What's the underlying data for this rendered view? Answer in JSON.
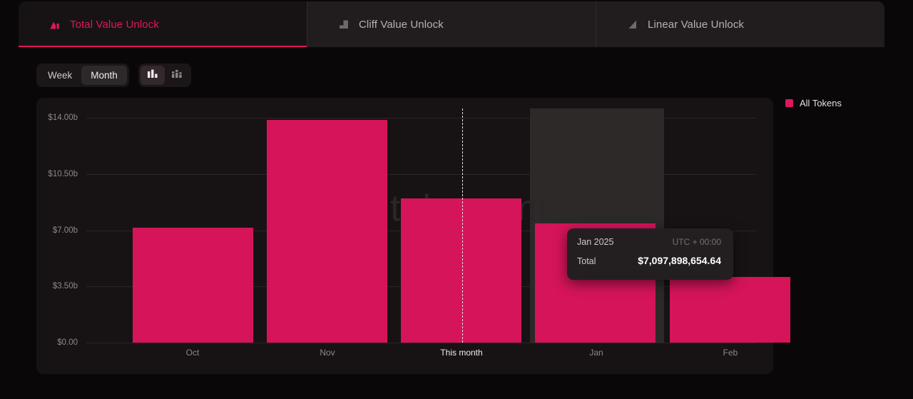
{
  "tabs": [
    {
      "label": "Total Value Unlock",
      "icon": "bars-ascending-icon",
      "active": true
    },
    {
      "label": "Cliff Value Unlock",
      "icon": "step-cliff-icon",
      "active": false
    },
    {
      "label": "Linear Value Unlock",
      "icon": "linear-ramp-icon",
      "active": false
    }
  ],
  "toolbar": {
    "week_label": "Week",
    "month_label": "Month",
    "selected_range": "Month",
    "chart_type_grouped_icon": "bar-chart-icon",
    "chart_type_stacked_icon": "stacked-bar-chart-icon",
    "selected_chart_type": "bar-chart-icon"
  },
  "legend": {
    "items": [
      {
        "label": "All Tokens",
        "color": "#e0165f"
      }
    ]
  },
  "tooltip": {
    "date": "Jan 2025",
    "timezone": "UTC + 00:00",
    "metric_label": "Total",
    "metric_value": "$7,097,898,654.64"
  },
  "watermark": "tokenomi",
  "colors": {
    "accent": "#e0165f",
    "bar": "#d5145a",
    "panel_bg": "#171314",
    "tabbar_bg": "#211d1e",
    "page_bg": "#0a0708",
    "highlight_col": "#2e2929"
  },
  "chart_data": {
    "type": "bar",
    "title": "",
    "xlabel": "",
    "ylabel": "",
    "categories": [
      "Oct",
      "Nov",
      "This month",
      "Jan",
      "Feb"
    ],
    "values": [
      6.84,
      13.56,
      8.98,
      7.42,
      4.09
    ],
    "value_labels": [
      "$6.84b",
      "$13.56b",
      "$8.98b",
      "$7.42b",
      "$4.09b"
    ],
    "series": [
      {
        "name": "All Tokens",
        "color": "#d5145a",
        "values": [
          6.84,
          13.56,
          8.98,
          7.42,
          4.09
        ]
      }
    ],
    "ylim": [
      0,
      14
    ],
    "yticks": [
      0,
      3.5,
      7.0,
      10.5,
      14.0
    ],
    "ytick_labels": [
      "$0.00",
      "$3.50b",
      "$7.00b",
      "$10.50b",
      "$14.00b"
    ],
    "grid": true,
    "legend_position": "right",
    "highlighted_category": "Jan",
    "current_marker_category": "This month",
    "hovered_value": "$7,097,898,654.64",
    "hovered_label": "Jan 2025"
  }
}
